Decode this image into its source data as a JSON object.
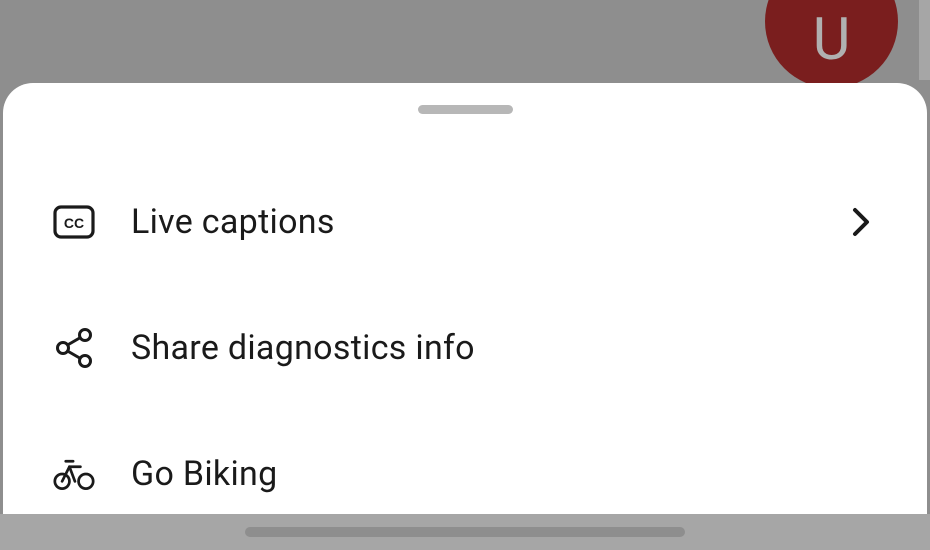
{
  "avatar": {
    "letter": "U"
  },
  "menu": {
    "items": [
      {
        "icon": "cc",
        "label": "Live captions",
        "has_chevron": true
      },
      {
        "icon": "share",
        "label": "Share diagnostics info",
        "has_chevron": false
      },
      {
        "icon": "bike",
        "label": "Go Biking",
        "has_chevron": false
      }
    ]
  }
}
